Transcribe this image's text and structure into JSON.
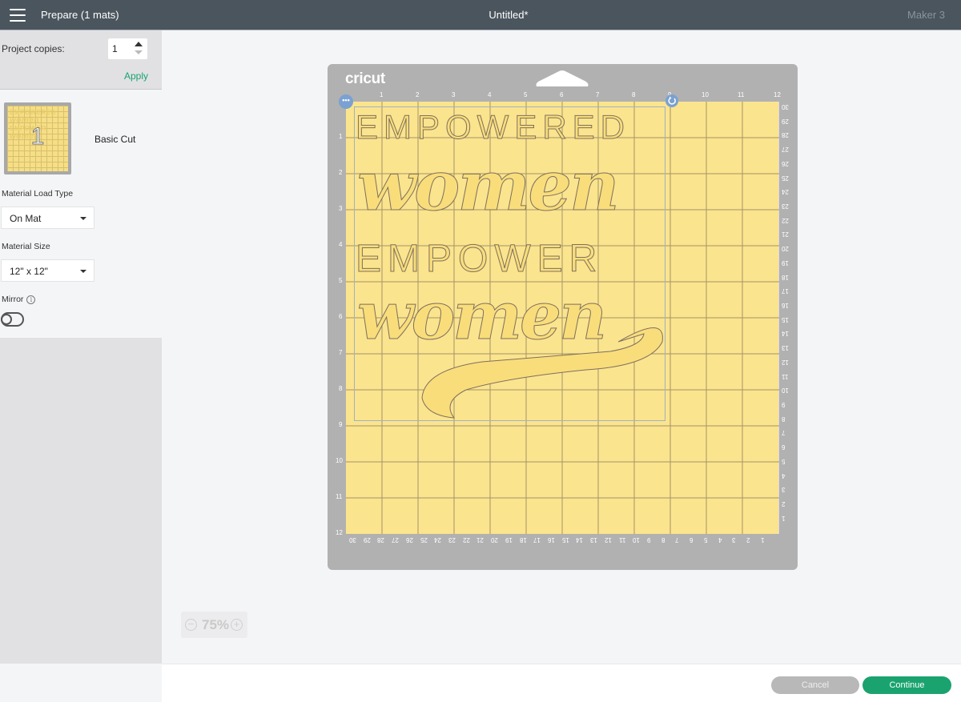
{
  "topbar": {
    "menu_icon": "hamburger-icon",
    "section_title": "Prepare (1 mats)",
    "document_title": "Untitled*",
    "machine": "Maker 3"
  },
  "copies": {
    "label": "Project copies:",
    "value": "1",
    "apply_label": "Apply"
  },
  "mats": [
    {
      "number": "1",
      "name": "Basic Cut",
      "thumb_text": [
        "EMPOWERED",
        "women",
        "EMPOWER",
        "women"
      ]
    }
  ],
  "settings": {
    "load_type_label": "Material Load Type",
    "load_type_value": "On Mat",
    "size_label": "Material Size",
    "size_value": "12\" x 12\"",
    "mirror_label": "Mirror",
    "mirror_info_icon": "info-icon",
    "mirror_on": false
  },
  "canvas": {
    "brand": "cricut",
    "design_lines": [
      "EMPOWERED",
      "women",
      "EMPOWER",
      "women"
    ],
    "top_ruler": [
      "1",
      "2",
      "3",
      "4",
      "5",
      "6",
      "7",
      "8",
      "9",
      "10",
      "11",
      "12"
    ],
    "left_ruler": [
      "1",
      "2",
      "3",
      "4",
      "5",
      "6",
      "7",
      "8",
      "9",
      "10",
      "11",
      "12"
    ],
    "right_ruler_cm": [
      "30",
      "29",
      "28",
      "27",
      "26",
      "25",
      "24",
      "23",
      "22",
      "21",
      "20",
      "19",
      "18",
      "17",
      "16",
      "15",
      "14",
      "13",
      "12",
      "11",
      "10",
      "9",
      "8",
      "7",
      "6",
      "5",
      "4",
      "3",
      "2",
      "1"
    ],
    "bottom_ruler_cm": [
      "30",
      "29",
      "28",
      "27",
      "26",
      "25",
      "24",
      "23",
      "22",
      "21",
      "20",
      "19",
      "18",
      "17",
      "16",
      "15",
      "14",
      "13",
      "12",
      "11",
      "10",
      "9",
      "8",
      "7",
      "6",
      "5",
      "4",
      "3",
      "2",
      "1"
    ],
    "menu_icon": "more-dots-icon",
    "rotate_icon": "rotate-icon"
  },
  "zoom": {
    "value": "75%",
    "minus": "−",
    "plus": "+"
  },
  "footer": {
    "cancel_label": "Cancel",
    "continue_label": "Continue"
  },
  "colors": {
    "accent": "#1aa36f",
    "topbar": "#4b555e",
    "mat": "#b1b1b1",
    "mat_surface": "#fbe48e",
    "design_fill": "#f9dd7a"
  }
}
